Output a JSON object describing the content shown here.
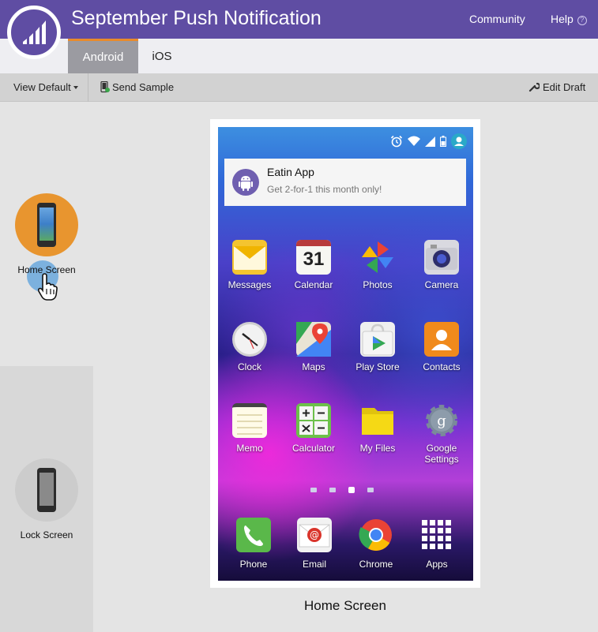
{
  "header": {
    "title": "September Push Notification",
    "community_label": "Community",
    "help_label": "Help"
  },
  "tabs": [
    {
      "label": "Android",
      "active": true
    },
    {
      "label": "iOS",
      "active": false
    }
  ],
  "toolbar": {
    "view_label": "View Default",
    "send_sample_label": "Send Sample",
    "edit_draft_label": "Edit Draft"
  },
  "views": [
    {
      "label": "Home Screen",
      "selected": true,
      "color": "#e8952f"
    },
    {
      "label": "Lock Screen",
      "selected": false,
      "color": "#cccccc"
    }
  ],
  "notification": {
    "app_name": "Eatin App",
    "message": "Get 2-for-1 this month only!"
  },
  "apps": {
    "row1": [
      "Messages",
      "Calendar",
      "Photos",
      "Camera"
    ],
    "row2": [
      "Clock",
      "Maps",
      "Play Store",
      "Contacts"
    ],
    "row3": [
      "Memo",
      "Calculator",
      "My Files",
      "Google Settings"
    ],
    "dock": [
      "Phone",
      "Email",
      "Chrome",
      "Apps"
    ],
    "calendar_day": "31"
  },
  "preview_caption": "Home Screen",
  "colors": {
    "brand_purple": "#5f4da3",
    "tab_accent": "#e98b2b",
    "home_view": "#e8952f"
  }
}
